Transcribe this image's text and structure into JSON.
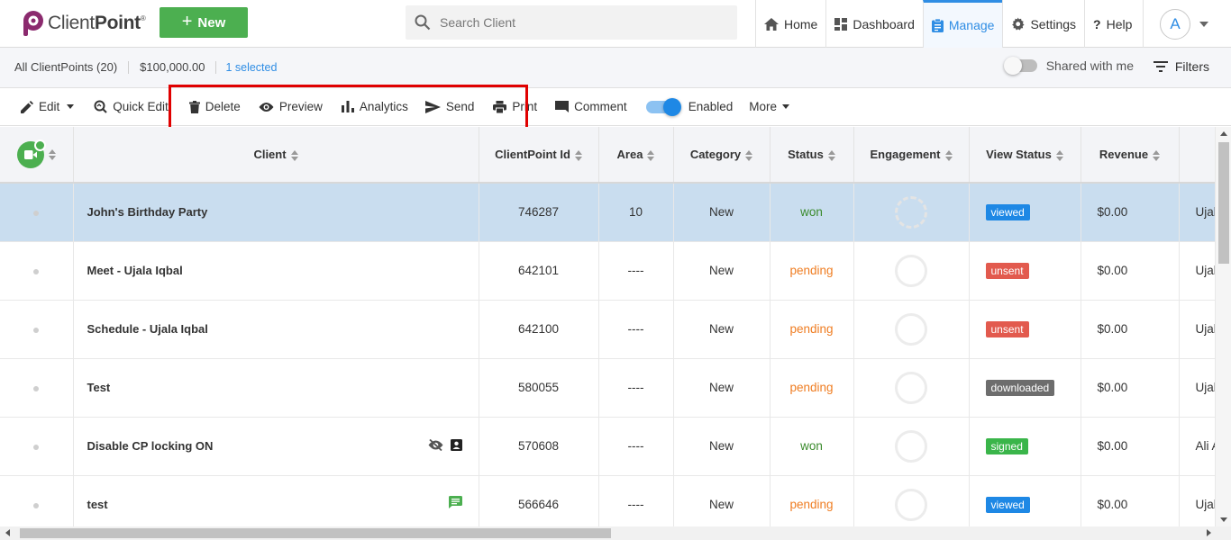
{
  "brand": {
    "name_light": "Client",
    "name_bold": "Point",
    "reg": "®"
  },
  "header": {
    "new_button": "New",
    "search_placeholder": "Search Client",
    "nav": [
      {
        "label": "Home",
        "icon": "home-icon"
      },
      {
        "label": "Dashboard",
        "icon": "dashboard-icon"
      },
      {
        "label": "Manage",
        "icon": "clipboard-icon",
        "active": true
      },
      {
        "label": "Settings",
        "icon": "gear-icon"
      },
      {
        "label": "Help",
        "icon": "question-icon"
      }
    ],
    "avatar_initial": "A"
  },
  "summary": {
    "all_clientpoints": "All ClientPoints (20)",
    "total": "$100,000.00",
    "selected": "1 selected",
    "shared_with_me": "Shared with me",
    "filters": "Filters"
  },
  "toolbar": {
    "edit": "Edit",
    "quick_edit": "Quick Edit",
    "delete": "Delete",
    "preview": "Preview",
    "analytics": "Analytics",
    "send": "Send",
    "print": "Print",
    "comment": "Comment",
    "enabled": "Enabled",
    "more": "More"
  },
  "table": {
    "columns": [
      "Client",
      "ClientPoint Id",
      "Area",
      "Category",
      "Status",
      "Engagement",
      "View Status",
      "Revenue"
    ],
    "rows": [
      {
        "client": "John's Birthday Party",
        "id": "746287",
        "area": "10",
        "category": "New",
        "status": "won",
        "view_status": "viewed",
        "revenue": "$0.00",
        "owner": "Ujal",
        "selected": true
      },
      {
        "client": "Meet - Ujala Iqbal",
        "id": "642101",
        "area": "----",
        "category": "New",
        "status": "pending",
        "view_status": "unsent",
        "revenue": "$0.00",
        "owner": "Ujal"
      },
      {
        "client": "Schedule - Ujala Iqbal",
        "id": "642100",
        "area": "----",
        "category": "New",
        "status": "pending",
        "view_status": "unsent",
        "revenue": "$0.00",
        "owner": "Ujal"
      },
      {
        "client": "Test",
        "id": "580055",
        "area": "----",
        "category": "New",
        "status": "pending",
        "view_status": "downloaded",
        "revenue": "$0.00",
        "owner": "Ujal"
      },
      {
        "client": "Disable CP locking ON",
        "id": "570608",
        "area": "----",
        "category": "New",
        "status": "won",
        "view_status": "signed",
        "revenue": "$0.00",
        "owner": "Ali A"
      },
      {
        "client": "test",
        "id": "566646",
        "area": "----",
        "category": "New",
        "status": "pending",
        "view_status": "viewed",
        "revenue": "$0.00",
        "owner": "Ujal"
      }
    ]
  },
  "colors": {
    "accent": "#2f8de4",
    "new_button": "#4caf50",
    "highlight": "#e00000",
    "selected_row": "#c9ddef"
  }
}
